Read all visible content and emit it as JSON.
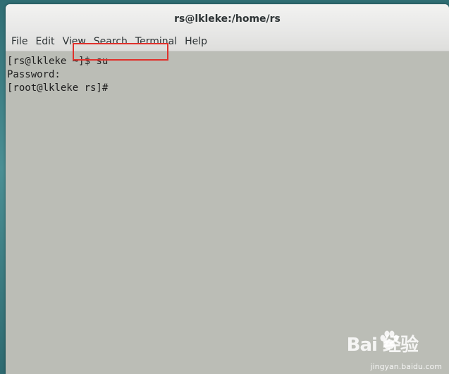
{
  "window": {
    "title": "rs@lkleke:/home/rs"
  },
  "menubar": {
    "items": [
      "File",
      "Edit",
      "View",
      "Search",
      "Terminal",
      "Help"
    ]
  },
  "terminal": {
    "lines": [
      "[rs@lkleke ~]$ su",
      "Password:",
      "[root@lkleke rs]#"
    ],
    "highlight_color": "#e0312b"
  },
  "watermark": {
    "logo": "Bai  经验",
    "url": "jingyan.baidu.com"
  },
  "colors": {
    "terminal_bg": "#bbbdb6",
    "header_bg": "#e8e8e7",
    "text": "#2e3436"
  }
}
